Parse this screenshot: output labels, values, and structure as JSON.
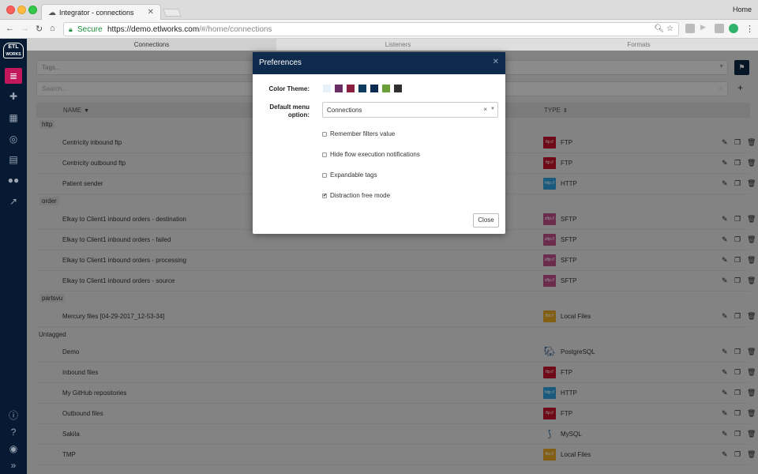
{
  "browser": {
    "tab_title": "Integrator - connections",
    "home_label": "Home",
    "secure_label": "Secure",
    "url_host": "https://demo.etlworks.com",
    "url_path": "/#/home/connections"
  },
  "logo": {
    "line1": "ETL",
    "line2": "WORKS"
  },
  "app_tabs": [
    "Connections",
    "Listeners",
    "Formats"
  ],
  "filters": {
    "tags_placeholder": "Tags...",
    "search_placeholder": "Search..."
  },
  "table": {
    "name_header": "NAME",
    "type_header": "TYPE"
  },
  "groups": [
    {
      "label": "http",
      "rows": [
        {
          "name": "Centricity inbound ftp",
          "type": "FTP",
          "icon": "ftp-icon",
          "icon_text": "ftp://"
        },
        {
          "name": "Centricity outbound ftp",
          "type": "FTP",
          "icon": "ftp-icon",
          "icon_text": "ftp://"
        },
        {
          "name": "Patient sender",
          "type": "HTTP",
          "icon": "http-icon",
          "icon_text": "http://"
        }
      ]
    },
    {
      "label": "order",
      "rows": [
        {
          "name": "Elkay to Client1 inbound orders - destination",
          "type": "SFTP",
          "icon": "sftp-icon",
          "icon_text": "sftp://"
        },
        {
          "name": "Elkay to Client1 inbound orders - failed",
          "type": "SFTP",
          "icon": "sftp-icon",
          "icon_text": "sftp://"
        },
        {
          "name": "Elkay to Client1 inbound orders - processing",
          "type": "SFTP",
          "icon": "sftp-icon",
          "icon_text": "sftp://"
        },
        {
          "name": "Elkay to Client1 inbound orders - source",
          "type": "SFTP",
          "icon": "sftp-icon",
          "icon_text": "sftp://"
        }
      ]
    },
    {
      "label": "partsvu",
      "rows": [
        {
          "name": "Mercury files [04-29-2017_12-53-34]",
          "type": "Local Files",
          "icon": "local-files-icon",
          "icon_text": "file://"
        }
      ]
    },
    {
      "label": "Untagged",
      "rows": [
        {
          "name": "Demo",
          "type": "PostgreSQL",
          "icon": "postgresql-icon",
          "icon_text": ""
        },
        {
          "name": "Inbound files",
          "type": "FTP",
          "icon": "ftp-icon",
          "icon_text": "ftp://"
        },
        {
          "name": "My GitHub repositories",
          "type": "HTTP",
          "icon": "http-icon",
          "icon_text": "http://"
        },
        {
          "name": "Outbound files",
          "type": "FTP",
          "icon": "ftp-icon",
          "icon_text": "ftp://"
        },
        {
          "name": "Sakila",
          "type": "MySQL",
          "icon": "mysql-icon",
          "icon_text": ""
        },
        {
          "name": "TMP",
          "type": "Local Files",
          "icon": "local-files-icon",
          "icon_text": "file://"
        }
      ]
    }
  ],
  "modal": {
    "title": "Preferences",
    "color_theme_label": "Color Theme:",
    "swatches": [
      "#e6f3fb",
      "#6b2d63",
      "#8a1f3f",
      "#0f3a5f",
      "#0a2a52",
      "#6aa038",
      "#2f2f2f"
    ],
    "menu_label_1": "Default menu",
    "menu_label_2": "option:",
    "menu_value": "Connections",
    "options": [
      {
        "label": "Remember filters value",
        "checked": false
      },
      {
        "label": "Hide flow execution notifications",
        "checked": false
      },
      {
        "label": "Expandable tags",
        "checked": false
      },
      {
        "label": "Distraction free mode",
        "checked": true
      }
    ],
    "close_label": "Close"
  }
}
